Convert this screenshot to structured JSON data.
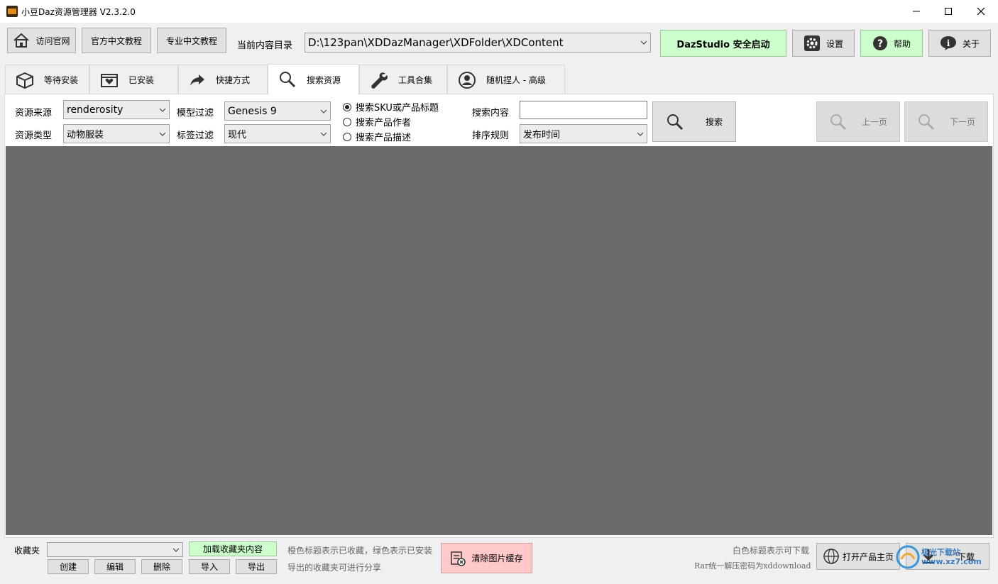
{
  "window": {
    "title": "小豆Daz资源管理器 V2.3.2.0",
    "app_icon": "app-logo",
    "controls": {
      "minimize": "—",
      "maximize": "☐",
      "close": "✕"
    }
  },
  "toolbar": {
    "visit_site": "访问官网",
    "official_tutorial": "官方中文教程",
    "pro_tutorial": "专业中文教程",
    "content_dir_label": "当前内容目录",
    "content_dir_value": "D:\\123pan\\XDDazManager\\XDFolder\\XDContent",
    "dazstudio_launch": "DazStudio 安全启动",
    "settings": "设置",
    "help": "帮助",
    "about": "关于"
  },
  "tabs": [
    {
      "label": "等待安装",
      "icon": "box-icon"
    },
    {
      "label": "已安装",
      "icon": "heart-box-icon"
    },
    {
      "label": "快捷方式",
      "icon": "share-arrow-icon"
    },
    {
      "label": "搜索资源",
      "icon": "search-icon"
    },
    {
      "label": "工具合集",
      "icon": "wrench-icon"
    },
    {
      "label": "随机捏人 - 高级",
      "icon": "user-icon"
    }
  ],
  "active_tab": "搜索资源",
  "filters": {
    "source_label": "资源来源",
    "source_value": "renderosity",
    "type_label": "资源类型",
    "type_value": "动物服装",
    "model_label": "模型过滤",
    "model_value": "Genesis 9",
    "tag_label": "标签过滤",
    "tag_value": "现代",
    "radios": [
      {
        "label": "搜索SKU或产品标题",
        "checked": true
      },
      {
        "label": "搜索产品作者",
        "checked": false
      },
      {
        "label": "搜索产品描述",
        "checked": false
      }
    ],
    "search_content_label": "搜索内容",
    "search_content_value": "",
    "sort_label": "排序规则",
    "sort_value": "发布时间",
    "search_button": "搜索",
    "prev_page": "上一页",
    "next_page": "下一页"
  },
  "footer": {
    "favorites_label": "收藏夹",
    "favorites_value": "",
    "load_favorites": "加载收藏夹内容",
    "create": "创建",
    "edit": "编辑",
    "delete": "删除",
    "import": "导入",
    "export": "导出",
    "hint1": "橙色标题表示已收藏，绿色表示已安装",
    "hint2": "导出的收藏夹可进行分享",
    "clear_cache": "清除图片缓存",
    "hint3": "白色标题表示可下载",
    "hint4": "Rar统一解压密码为xddownload",
    "open_product_page": "打开产品主页",
    "download": "下载"
  },
  "watermark": "极光下载站 www.xz7.com",
  "colors": {
    "content_area": "#6a6a6a",
    "green_button": "#ccffcc",
    "pink_button": "#ffc9c9"
  }
}
